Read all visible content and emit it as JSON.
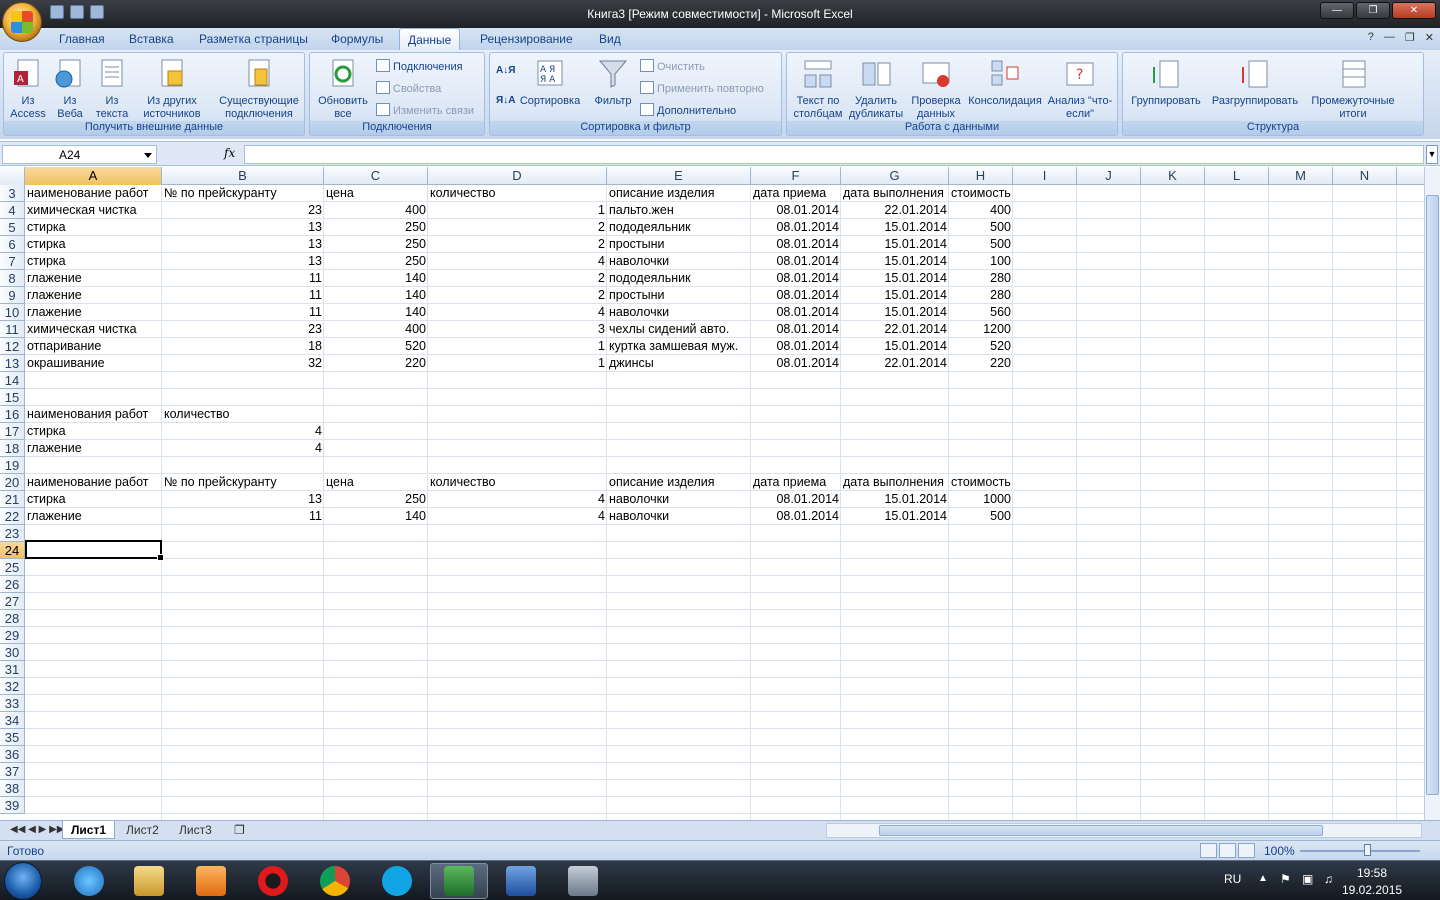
{
  "window": {
    "title": "Книга3  [Режим совместимости]  -  Microsoft Excel"
  },
  "ribbon_tabs": [
    "Главная",
    "Вставка",
    "Разметка страницы",
    "Формулы",
    "Данные",
    "Рецензирование",
    "Вид"
  ],
  "ribbon": {
    "groups": {
      "external": "Получить внешние данные",
      "connections": "Подключения",
      "sort_filter": "Сортировка и фильтр",
      "data_tools": "Работа с данными",
      "outline": "Структура"
    },
    "buttons": {
      "from_access": "Из Access",
      "from_web": "Из Веба",
      "from_text": "Из текста",
      "from_other": "Из других источников",
      "existing": "Существующие подключения",
      "refresh_all": "Обновить все",
      "connections": "Подключения",
      "properties": "Свойства",
      "edit_links": "Изменить связи",
      "sort": "Сортировка",
      "filter": "Фильтр",
      "clear": "Очистить",
      "reapply": "Применить повторно",
      "advanced": "Дополнительно",
      "text_to_columns": "Текст по столбцам",
      "remove_duplicates": "Удалить дубликаты",
      "data_validation": "Проверка данных",
      "consolidate": "Консолидация",
      "what_if": "Анализ \"что-если\"",
      "group": "Группировать",
      "ungroup": "Разгруппировать",
      "subtotal": "Промежуточные итоги"
    }
  },
  "formula_bar": {
    "name_box": "A24",
    "fx": "fx",
    "formula": ""
  },
  "columns": [
    "A",
    "B",
    "C",
    "D",
    "E",
    "F",
    "G",
    "H",
    "I",
    "J",
    "K",
    "L",
    "M",
    "N"
  ],
  "rows": [
    "3",
    "4",
    "5",
    "6",
    "7",
    "8",
    "9",
    "10",
    "11",
    "12",
    "13",
    "14",
    "15",
    "16",
    "17",
    "18",
    "19",
    "20",
    "21",
    "22",
    "23",
    "24",
    "25",
    "26",
    "27",
    "28",
    "29",
    "30",
    "31",
    "32",
    "33",
    "34",
    "35",
    "36",
    "37",
    "38",
    "39"
  ],
  "selected_cell": "A24",
  "table1": {
    "headers": [
      "наименование работ",
      "№ по прейскуранту",
      "цена",
      "количество",
      "описание изделия",
      "дата приема",
      "дата выполнения",
      "стоимость"
    ],
    "rows": [
      [
        "химическая чистка",
        "23",
        "400",
        "1",
        "пальто.жен",
        "08.01.2014",
        "22.01.2014",
        "400"
      ],
      [
        "стирка",
        "13",
        "250",
        "2",
        "пододеяльник",
        "08.01.2014",
        "15.01.2014",
        "500"
      ],
      [
        "стирка",
        "13",
        "250",
        "2",
        "простыни",
        "08.01.2014",
        "15.01.2014",
        "500"
      ],
      [
        "стирка",
        "13",
        "250",
        "4",
        "наволочки",
        "08.01.2014",
        "15.01.2014",
        "100"
      ],
      [
        "глажение",
        "11",
        "140",
        "2",
        "пододеяльник",
        "08.01.2014",
        "15.01.2014",
        "280"
      ],
      [
        "глажение",
        "11",
        "140",
        "2",
        "простыни",
        "08.01.2014",
        "15.01.2014",
        "280"
      ],
      [
        "глажение",
        "11",
        "140",
        "4",
        "наволочки",
        "08.01.2014",
        "15.01.2014",
        "560"
      ],
      [
        "химическая чистка",
        "23",
        "400",
        "3",
        "чехлы сидений авто.",
        "08.01.2014",
        "22.01.2014",
        "1200"
      ],
      [
        "отпаривание",
        "18",
        "520",
        "1",
        "куртка замшевая муж.",
        "08.01.2014",
        "15.01.2014",
        "520"
      ],
      [
        "окрашивание",
        "32",
        "220",
        "1",
        "джинсы",
        "08.01.2014",
        "22.01.2014",
        "220"
      ]
    ]
  },
  "criteria": {
    "headers": [
      "наименования работ",
      "количество"
    ],
    "rows": [
      [
        "стирка",
        "4"
      ],
      [
        "глажение",
        "4"
      ]
    ]
  },
  "table2": {
    "headers": [
      "наименование работ",
      "№ по прейскуранту",
      "цена",
      "количество",
      "описание изделия",
      "дата приема",
      "дата выполнения",
      "стоимость"
    ],
    "rows": [
      [
        "стирка",
        "13",
        "250",
        "4",
        "наволочки",
        "08.01.2014",
        "15.01.2014",
        "1000"
      ],
      [
        "глажение",
        "11",
        "140",
        "4",
        "наволочки",
        "08.01.2014",
        "15.01.2014",
        "500"
      ]
    ]
  },
  "sheet_tabs": [
    "Лист1",
    "Лист2",
    "Лист3"
  ],
  "status": {
    "text": "Готово",
    "zoom": "100%"
  },
  "taskbar": {
    "lang": "RU",
    "time": "19:58",
    "date": "19.02.2015"
  }
}
